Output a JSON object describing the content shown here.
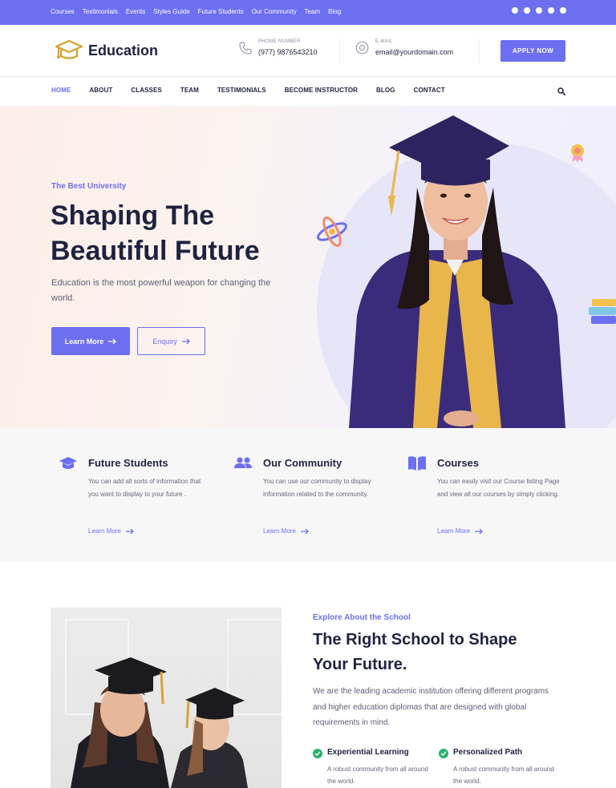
{
  "topbar": {
    "links": [
      "Courses",
      "Testimonials",
      "Events",
      "Styles Guide",
      "Future Students",
      "Our Community",
      "Team",
      "Blog"
    ],
    "social_icons": [
      "facebook-icon",
      "twitter-icon",
      "instagram-icon",
      "dribbble-icon",
      "pinterest-icon"
    ]
  },
  "header": {
    "brand": "Education",
    "phone_label": "PHONE NUMBER",
    "phone_value": "(977) 9876543210",
    "email_label": "E-MAIL",
    "email_value": "email@yourdomain.com",
    "apply_label": "APPLY NOW"
  },
  "nav": {
    "items": [
      "HOME",
      "ABOUT",
      "CLASSES",
      "TEAM",
      "TESTIMONIALS",
      "BECOME INSTRUCTOR",
      "BLOG",
      "CONTACT"
    ],
    "active": "HOME"
  },
  "hero": {
    "eyebrow": "The Best University",
    "title_line1": "Shaping The",
    "title_line2": "Beautiful Future",
    "description": "Education is the most powerful weapon for changing the world.",
    "primary_button": "Learn More",
    "secondary_button": "Enquiry"
  },
  "features": [
    {
      "icon": "graduation-cap-icon",
      "title": "Future Students",
      "text": "You can add all sorts of information that you want to display to your future .",
      "link": "Learn More"
    },
    {
      "icon": "users-icon",
      "title": "Our Community",
      "text": "You can use our community to display information related to the community.",
      "link": "Learn More"
    },
    {
      "icon": "book-icon",
      "title": "Courses",
      "text": "You can easily visit our Course listing Page and view all our courses by simply clicking.",
      "link": "Learn More"
    }
  ],
  "about": {
    "eyebrow": "Explore About the School",
    "title": "The Right School to Shape Your Future.",
    "description": "We are the leading academic institution offering different programs and higher education diplomas that are designed with global requirements in mind.",
    "points": [
      {
        "title": "Experiential Learning",
        "text": "A robust community from all around the world."
      },
      {
        "title": "Personalized Path",
        "text": "A robust community from all around the world."
      }
    ]
  },
  "colors": {
    "accent": "#6c6ff0",
    "dark": "#1f2340",
    "check": "#27b36a"
  }
}
